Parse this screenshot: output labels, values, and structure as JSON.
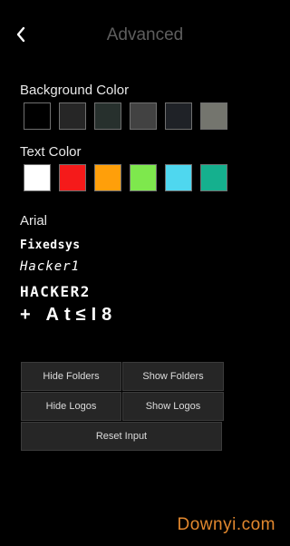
{
  "header": {
    "title": "Advanced"
  },
  "background_color": {
    "label": "Background Color",
    "swatches": [
      "#000000",
      "#262626",
      "#27302d",
      "#424242",
      "#1f2227",
      "#74756e"
    ]
  },
  "text_color": {
    "label": "Text Color",
    "swatches": [
      "#ffffff",
      "#f51a1a",
      "#ff9f0a",
      "#7ee84d",
      "#4fd7ef",
      "#15b08e"
    ]
  },
  "fonts": {
    "arial": "Arial",
    "fixedsys": "Fixedsys",
    "hacker1": "Hacker1",
    "hacker2": "HACKER2",
    "glyphs": "+ At≤I8"
  },
  "buttons": {
    "hide_folders": "Hide Folders",
    "show_folders": "Show Folders",
    "hide_logos": "Hide Logos",
    "show_logos": "Show Logos",
    "reset_input": "Reset Input"
  },
  "watermark": "Downyi.com"
}
